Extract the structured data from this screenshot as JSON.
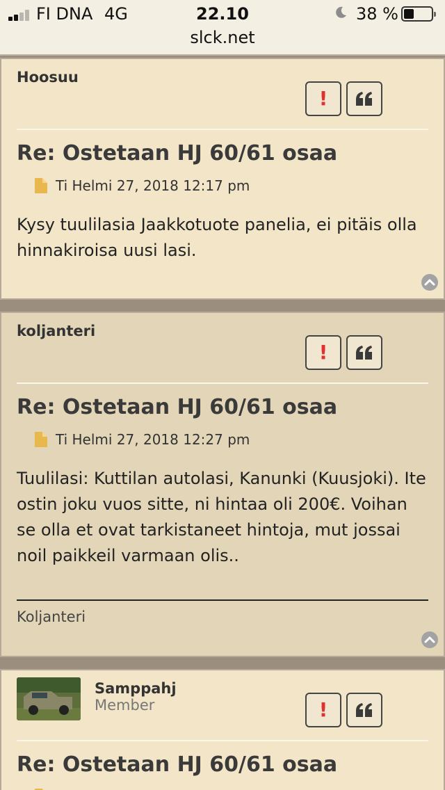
{
  "status_bar": {
    "carrier": "FI DNA",
    "network": "4G",
    "time": "22.10",
    "battery_percent": "38 %",
    "url": "slck.net"
  },
  "posts": [
    {
      "author": "Hoosuu",
      "title": "Re: Ostetaan HJ 60/61 osaa",
      "date": "Ti Helmi 27, 2018 12:17 pm",
      "content": "Kysy tuulilasia Jaakkotuote panelia, ei pitäis olla hinnakiroisa uusi lasi."
    },
    {
      "author": "koljanteri",
      "title": "Re: Ostetaan HJ 60/61 osaa",
      "date": "Ti Helmi 27, 2018 12:27 pm",
      "content": "Tuulilasi: Kuttilan autolasi, Kanunki (Kuusjoki). Ite ostin joku vuos sitte, ni hintaa oli 200€. Voihan se olla et ovat tarkistaneet hintoja, mut jossai noil paikkeil varmaan olis..",
      "signature": "Koljanteri"
    },
    {
      "author": "Samppahj",
      "rank": "Member",
      "title": "Re: Ostetaan HJ 60/61 osaa"
    }
  ],
  "icons": {
    "report": "!",
    "quote": "quote-icon",
    "post_file": "file-icon",
    "back_to_top": "chevron-up-circle-icon"
  },
  "colors": {
    "post_light": "#f2e5c8",
    "post_dark": "#e3d6b8",
    "separator": "#9b8e7e",
    "report_red": "#e03030"
  }
}
